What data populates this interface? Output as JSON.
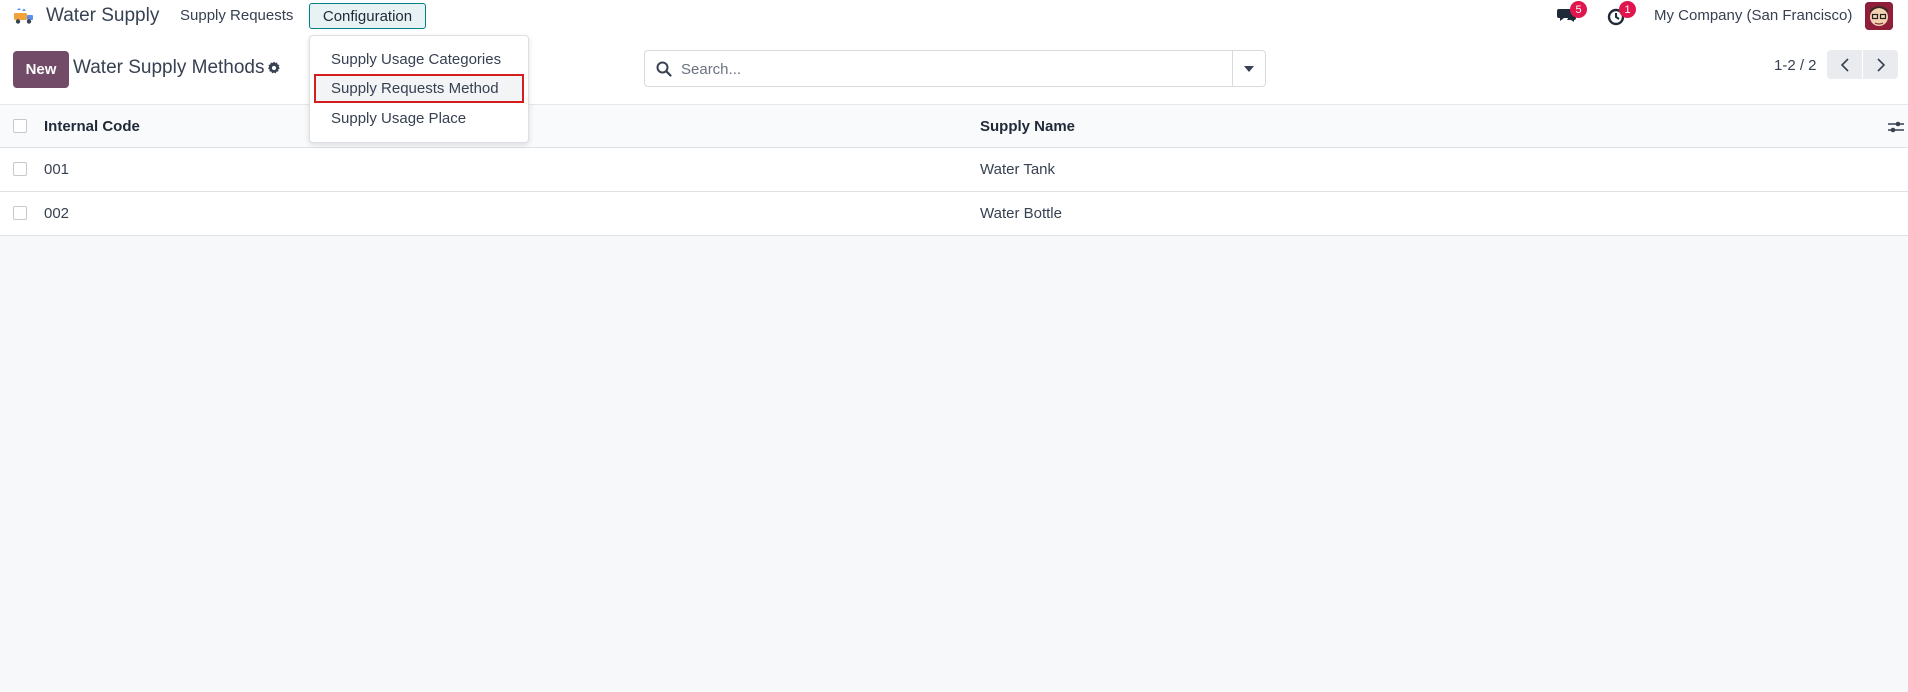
{
  "navbar": {
    "brand": "Water Supply",
    "menu": [
      {
        "label": "Supply Requests"
      },
      {
        "label": "Configuration"
      }
    ],
    "messages_badge": "5",
    "activities_badge": "1",
    "company": "My Company (San Francisco)"
  },
  "control": {
    "new_label": "New",
    "title": "Water Supply Methods",
    "search_placeholder": "Search...",
    "pager": "1-2 / 2"
  },
  "dropdown": {
    "items": [
      {
        "label": "Supply Usage Categories"
      },
      {
        "label": "Supply Requests Method"
      },
      {
        "label": "Supply Usage Place"
      }
    ]
  },
  "table": {
    "columns": [
      "Internal Code",
      "Supply Name"
    ],
    "rows": [
      {
        "code": "001",
        "name": "Water Tank"
      },
      {
        "code": "002",
        "name": "Water Bottle"
      }
    ]
  },
  "colors": {
    "primary": "#714b67",
    "accent": "#017e84",
    "badge": "#e0174e",
    "highlight_border": "#d41e1e"
  }
}
